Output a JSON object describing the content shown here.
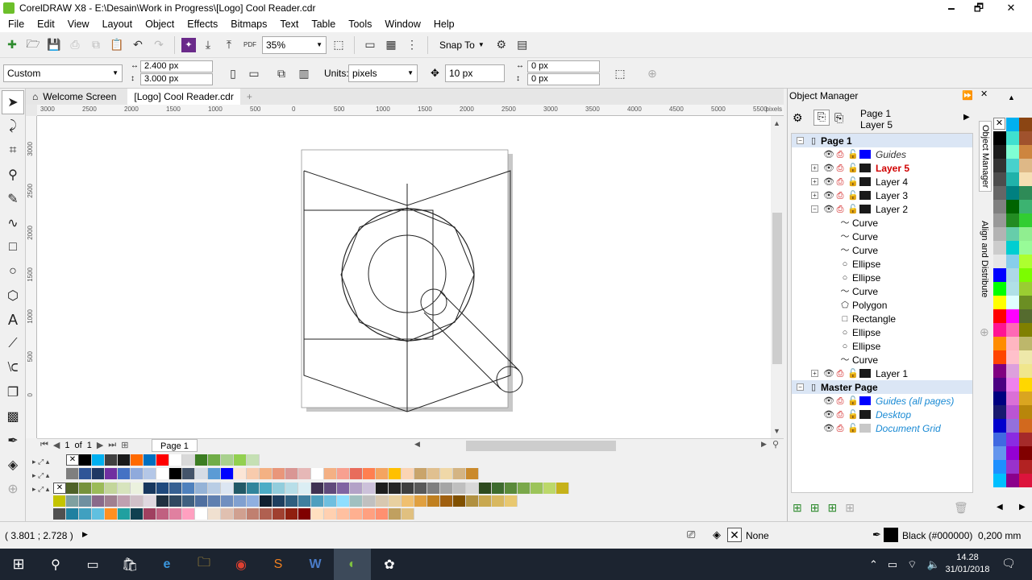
{
  "window": {
    "title": "CorelDRAW X8 - E:\\Desain\\Work in Progress\\[Logo] Cool Reader.cdr",
    "minimize": "🗕",
    "restore": "🗗",
    "close": "✕"
  },
  "menu": [
    "File",
    "Edit",
    "View",
    "Layout",
    "Object",
    "Effects",
    "Bitmaps",
    "Text",
    "Table",
    "Tools",
    "Window",
    "Help"
  ],
  "toolbar": {
    "zoom": "35%",
    "snap_to": "Snap To"
  },
  "propertybar": {
    "preset": "Custom",
    "width": "2.400 px",
    "height": "3.000 px",
    "units_label": "Units:",
    "units": "pixels",
    "nudge": "10 px",
    "dup_x": "0 px",
    "dup_y": "0 px"
  },
  "tabs": {
    "welcome": "Welcome Screen",
    "doc": "[Logo] Cool Reader.cdr"
  },
  "ruler": {
    "h": [
      "3000",
      "2500",
      "2000",
      "1500",
      "1000",
      "500",
      "0",
      "500",
      "1000",
      "1500",
      "2000",
      "2500",
      "3000",
      "3500",
      "4000",
      "4500",
      "5000",
      "5500"
    ],
    "unit": "pixels",
    "v": [
      "3000",
      "2500",
      "2000",
      "1500",
      "1000",
      "500",
      "0"
    ]
  },
  "pagenav": {
    "current": "1",
    "of": "of",
    "total": "1",
    "page_tab": "Page 1"
  },
  "object_manager": {
    "title": "Object Manager",
    "header_page": "Page 1",
    "header_layer": "Layer 5",
    "page1": "Page 1",
    "page1_rows": [
      {
        "label": "Guides",
        "type": "guides",
        "color": "#0000ff"
      },
      {
        "label": "Layer 5",
        "type": "active",
        "color": "#1a1a1a"
      },
      {
        "label": "Layer 4",
        "type": "layer",
        "color": "#1a1a1a"
      },
      {
        "label": "Layer 3",
        "type": "layer",
        "color": "#1a1a1a"
      }
    ],
    "layer2": "Layer 2",
    "layer2_color": "#1a1a1a",
    "objects": [
      {
        "label": "Curve",
        "icon": "〜"
      },
      {
        "label": "Curve",
        "icon": "〜"
      },
      {
        "label": "Curve",
        "icon": "〜"
      },
      {
        "label": "Ellipse",
        "icon": "○"
      },
      {
        "label": "Ellipse",
        "icon": "○"
      },
      {
        "label": "Curve",
        "icon": "〜"
      },
      {
        "label": "Polygon",
        "icon": "⬠"
      },
      {
        "label": "Rectangle",
        "icon": "□"
      },
      {
        "label": "Ellipse",
        "icon": "○"
      },
      {
        "label": "Ellipse",
        "icon": "○"
      },
      {
        "label": "Curve",
        "icon": "〜"
      }
    ],
    "layer1": "Layer 1",
    "master": "Master Page",
    "master_rows": [
      {
        "label": "Guides (all pages)",
        "color": "#0000ff"
      },
      {
        "label": "Desktop",
        "color": "#1a1a1a"
      },
      {
        "label": "Document Grid",
        "color": "#c8c8c8"
      }
    ]
  },
  "side_tabs": {
    "om": "Object Manager",
    "align": "Align and Distribute"
  },
  "status": {
    "coords": "( 3.801 ; 2.728 )",
    "fill": "None",
    "outline": "Black (#000000)  0,200 mm"
  },
  "taskbar": {
    "time": "14.28",
    "date": "31/01/2018"
  },
  "colors": {
    "doc_row1": [
      "#000000",
      "#00b0f0",
      "#404040",
      "#1a1a1a",
      "#ff6a00",
      "#0070c0",
      "#ff0000",
      "#ffffff",
      "#d9d9d9",
      "#3c7d22",
      "#70ad47",
      "#a9d18e",
      "#92d050",
      "#c5e0b4"
    ],
    "doc_row2": [
      "#7f7f7f",
      "#2f5597",
      "#1f3864",
      "#7030a0",
      "#4472c4",
      "#8faadc",
      "#b4c7e7",
      "#ffffff",
      "#000000",
      "#44546a",
      "#d6dce5",
      "#5b9bd5",
      "#0000ff",
      "#fbe5d6",
      "#f8cbad",
      "#f4b183",
      "#e9967a",
      "#d99694",
      "#e6b8b7",
      "#ffffff",
      "#f4b084",
      "#f8a090",
      "#e86c5c",
      "#ff7f50",
      "#f4a460",
      "#ffc000",
      "#fbd4b4",
      "#c9a46b",
      "#e0c090",
      "#f0d8a8",
      "#d4b483",
      "#ca8a2c"
    ],
    "doc_row3": [
      "#4f6228",
      "#76923c",
      "#9bbb59",
      "#c3d69b",
      "#d7e4bd",
      "#ebf1de",
      "#17375e",
      "#1f497d",
      "#366092",
      "#4f81bd",
      "#95b3d7",
      "#b9cde5",
      "#dce6f2",
      "#215967",
      "#31859c",
      "#4bacc6",
      "#92cddc",
      "#b7dee8",
      "#dbeef4",
      "#403152",
      "#604a7b",
      "#8064a2",
      "#b3a2c7",
      "#ccc1da",
      "#1d1d1d",
      "#262626",
      "#3f3f3f",
      "#595959",
      "#7f7f7f",
      "#a5a5a5",
      "#bfbfbf",
      "#d8d8d8",
      "#2e4a1e",
      "#3e6b2e",
      "#5a8a3a",
      "#7aa84a",
      "#9cc45a",
      "#bcd86a",
      "#c6b21a"
    ],
    "doc_row4": [
      "#c4c400",
      "#7fa0a0",
      "#6f8fa0",
      "#8a6a8a",
      "#a08090",
      "#c0a0b0",
      "#d0c0c8",
      "#e0d8e0",
      "#203040",
      "#304860",
      "#406080",
      "#5070a0",
      "#6080b0",
      "#708fc0",
      "#80a0d0",
      "#90b0e0",
      "#102030",
      "#1f3f5f",
      "#2f5f7f",
      "#3f7f9f",
      "#4f9fbf",
      "#6fbfdf",
      "#8fdfff",
      "#a0c0c0",
      "#c0c0c0",
      "#d8c8b0",
      "#e8d0a0",
      "#f0c070",
      "#e0a040",
      "#c08020",
      "#a06010",
      "#805000",
      "#b09040",
      "#c8a850",
      "#d8b860",
      "#e8c870"
    ],
    "doc_row5": [
      "#505050",
      "#2080a0",
      "#40a0c0",
      "#60c0e0",
      "#ff9020",
      "#20a0a0",
      "#104050",
      "#a04060",
      "#c06080",
      "#e080a0",
      "#ffa0c0",
      "#ffffff",
      "#f0e0d0",
      "#e0c0b0",
      "#d0a090",
      "#c08070",
      "#b06050",
      "#a04030",
      "#902010",
      "#800000",
      "#ffe0c0",
      "#ffd0b0",
      "#ffc0a0",
      "#ffb090",
      "#ffa080",
      "#ff9070",
      "#c0a060",
      "#e0c080"
    ],
    "right_pal": [
      "#ffffff",
      "#00b0f0",
      "#8b4513",
      "#000000",
      "#40e0d0",
      "#a0522d",
      "#1a1a1a",
      "#7fffd4",
      "#cd853f",
      "#333333",
      "#48d1cc",
      "#deb887",
      "#4d4d4d",
      "#20b2aa",
      "#f5deb3",
      "#666666",
      "#008080",
      "#2e8b57",
      "#808080",
      "#006400",
      "#3cb371",
      "#999999",
      "#228b22",
      "#32cd32",
      "#b3b3b3",
      "#66cdaa",
      "#90ee90",
      "#cccccc",
      "#00ced1",
      "#98fb98",
      "#e6e6e6",
      "#87ceeb",
      "#adff2f",
      "#0000ff",
      "#add8e6",
      "#7cfc00",
      "#00ff00",
      "#b0e0e6",
      "#9acd32",
      "#ffff00",
      "#e0ffff",
      "#6b8e23",
      "#ff0000",
      "#ff00ff",
      "#556b2f",
      "#ff1493",
      "#ff69b4",
      "#808000",
      "#ff8c00",
      "#ffb6c1",
      "#bdb76b",
      "#ff4500",
      "#ffc0cb",
      "#eee8aa",
      "#800080",
      "#dda0dd",
      "#f0e68c",
      "#4b0082",
      "#ee82ee",
      "#ffd700",
      "#000080",
      "#da70d6",
      "#daa520",
      "#191970",
      "#ba55d3",
      "#b8860b",
      "#0000cd",
      "#9370db",
      "#d2691e",
      "#4169e1",
      "#8a2be2",
      "#a52a2a",
      "#6495ed",
      "#9400d3",
      "#800000",
      "#1e90ff",
      "#9932cc",
      "#b22222",
      "#00bfff",
      "#8b008b",
      "#dc143c"
    ]
  }
}
